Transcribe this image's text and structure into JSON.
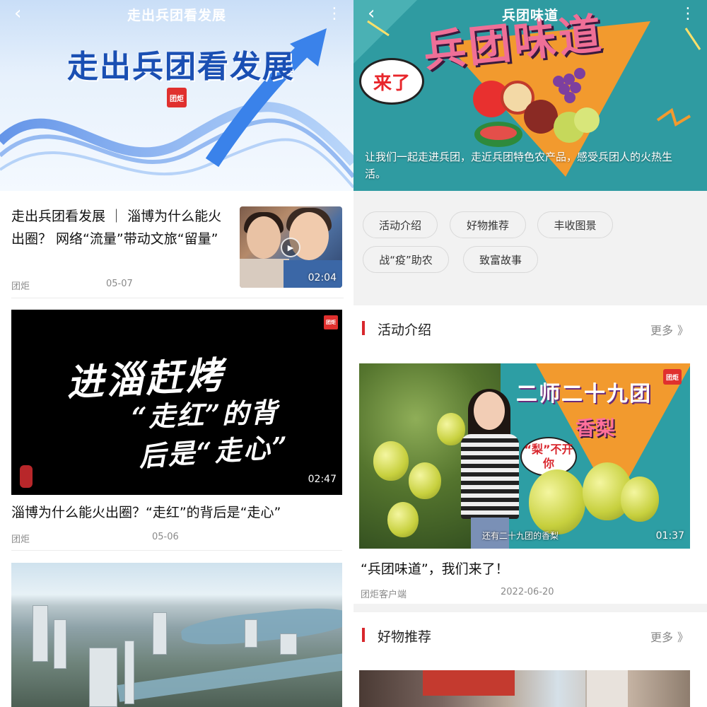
{
  "left": {
    "header": {
      "title": "走出兵团看发展",
      "back_icon": "‹",
      "more_icon": "⋮"
    },
    "hero": {
      "title": "走出兵团看发展",
      "logo_text": "团炬"
    },
    "articles": [
      {
        "title": "走出兵团看发展 ｜ 淄博为什么能火出圈？ 网络“流量”带动文旅“留量”",
        "source": "团炬",
        "date": "05-07",
        "duration": "02:04"
      },
      {
        "title": "淄博为什么能火出圈？“走红”的背后是“走心”",
        "source": "团炬",
        "date": "05-06",
        "duration": "02:47",
        "handwriting": [
          "进淄赶烤",
          "“走红”的背",
          "后是“走心”"
        ],
        "logo_text": "团炬"
      }
    ]
  },
  "right": {
    "header": {
      "title": "兵团味道",
      "back_icon": "‹",
      "more_icon": "⋮"
    },
    "hero": {
      "banner": "兵团味道",
      "bubble": "来了",
      "description": "让我们一起走进兵团，走近兵团特色农产品，感受兵团人的火热生活。"
    },
    "tags": [
      "活动介绍",
      "好物推荐",
      "丰收图景",
      "战“疫”助农",
      "致富故事"
    ],
    "sections": [
      {
        "title": "活动介绍",
        "more": "更多",
        "video": {
          "title1": "二师二十九团",
          "title2": "香梨",
          "bubble": "“梨”不开你",
          "subtitle": "还有二十九团的香梨",
          "duration": "01:37",
          "logo_text": "团炬"
        },
        "article": {
          "title": "“兵团味道”，我们来了！",
          "source": "团炬客户端",
          "date": "2022-06-20"
        }
      },
      {
        "title": "好物推荐",
        "more": "更多"
      }
    ],
    "more_chevron": "》"
  },
  "colors": {
    "accent_red": "#d8272d",
    "hero_blue": "#1a4fb3",
    "teal": "#2f9ba1",
    "orange": "#f29a2e",
    "pink": "#ef6f97"
  }
}
